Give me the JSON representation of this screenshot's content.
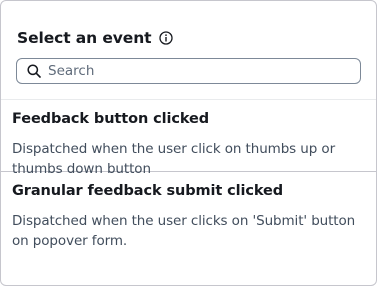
{
  "header": {
    "title": "Select an event",
    "info_icon": "info-circle-icon"
  },
  "search": {
    "placeholder": "Search",
    "value": "",
    "icon": "search-icon"
  },
  "events": [
    {
      "name": "Feedback button clicked",
      "description": "Dispatched when the user click on thumbs up or thumbs down button"
    },
    {
      "name": "Granular feedback submit clicked",
      "description": "Dispatched when the user clicks on 'Submit' button on popover form."
    }
  ],
  "colors": {
    "text": "#16191f",
    "secondary_text": "#414d5c",
    "border": "#c6c6cd",
    "input_border": "#7d8998",
    "placeholder": "#5f6b7a"
  }
}
